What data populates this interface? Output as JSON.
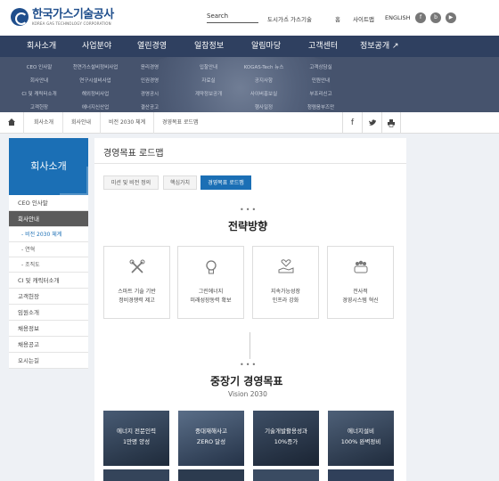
{
  "brand": {
    "name": "한국가스기술공사",
    "sub": "KOREA GAS TECHNOLOGY CORPORATION"
  },
  "utility": {
    "search_label": "Search",
    "links": [
      "도시가스",
      "가스기술",
      "홈",
      "사이트맵",
      "ENGLISH"
    ],
    "link_sep": "|",
    "sns_icons": [
      "facebook-icon",
      "blog-icon",
      "youtube-icon"
    ]
  },
  "gnb": [
    "회사소개",
    "사업분야",
    "열린경영",
    "일참정보",
    "알림마당",
    "고객센터",
    "정보공개"
  ],
  "submenu": [
    [
      "CEO 인사말",
      "회사안내",
      "CI 및 캐릭터소개",
      "고객헌장"
    ],
    [
      "천연가스설비정비사업",
      "연구시설비사업",
      "해외정비사업",
      "에너지신산업"
    ],
    [
      "윤리경영",
      "인권경영",
      "경영공시",
      "결산공고"
    ],
    [
      "입찰안내",
      "자료실",
      "계약정보공개"
    ],
    [
      "KOGAS-Tech 뉴스",
      "공지사항",
      "사이버홍보실",
      "행사일정"
    ],
    [
      "고객상담실",
      "민원안내",
      "부조리신고",
      "청렴옴부즈만"
    ]
  ],
  "breadcrumb": [
    "회사소개",
    "회사안내",
    "비전 2030 체계",
    "경영목표 로드맵"
  ],
  "actions": [
    "f",
    "twitter-icon",
    "print-icon"
  ],
  "sidebar": {
    "title": "회사소개",
    "items": [
      {
        "label": "CEO 인사말",
        "cls": ""
      },
      {
        "label": "회사안내",
        "cls": "on"
      },
      {
        "label": "- 비전 2030 체계",
        "cls": "subi cur"
      },
      {
        "label": "- 연혁",
        "cls": "subi"
      },
      {
        "label": "- 조직도",
        "cls": "subi"
      },
      {
        "label": "CI 및 캐릭터소개",
        "cls": ""
      },
      {
        "label": "고객헌장",
        "cls": ""
      },
      {
        "label": "임원소개",
        "cls": ""
      },
      {
        "label": "채용정보",
        "cls": ""
      },
      {
        "label": "채용공고",
        "cls": ""
      },
      {
        "label": "오시는길",
        "cls": ""
      }
    ]
  },
  "page": {
    "title": "경영목표 로드맵",
    "tabs": [
      "미션 및 비전 정의",
      "핵심가치",
      "경영목표 로드맵"
    ],
    "active_tab": 2,
    "strategy": {
      "heading": "전략방향",
      "cards": [
        {
          "icon": "tools-icon",
          "line1": "스마트 기술 기반",
          "line2": "정비경쟁력 제고"
        },
        {
          "icon": "lightbulb-icon",
          "line1": "그린에너지",
          "line2": "미래성장동력 확보"
        },
        {
          "icon": "heart-hand-icon",
          "line1": "지속가능성장",
          "line2": "인프라 강화"
        },
        {
          "icon": "people-icon",
          "line1": "전사적",
          "line2": "경영시스템 혁신"
        }
      ]
    },
    "goals": {
      "heading": "중장기 경영목표",
      "subheading": "Vision 2030",
      "items": [
        {
          "line1": "에너지 전문인력",
          "line2": "1만명 양성"
        },
        {
          "line1": "중대재해사고",
          "line2": "ZERO 달성"
        },
        {
          "line1": "기술개발활용성과",
          "line2": "10%증가"
        },
        {
          "line1": "에너지설비",
          "line2": "100% 완벽정비"
        }
      ]
    }
  },
  "colors": {
    "primary": "#1b6fb5",
    "gnb": "#2f4060",
    "submenu": "#46536d"
  }
}
